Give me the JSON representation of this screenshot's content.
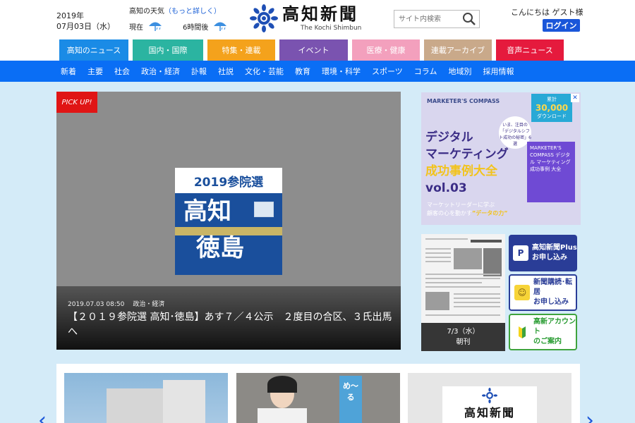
{
  "header": {
    "date_year": "2019年",
    "date_day": "07月03日（水）",
    "weather_label": "高知の天気",
    "weather_more": "（もっと詳しく）",
    "weather_now": "現在",
    "weather_later": "6時間後",
    "logo_title": "高知新聞",
    "logo_sub": "The Kochi Shimbun",
    "search_placeholder": "サイト内検索",
    "greeting": "こんにちは ゲスト様",
    "login_label": "ログイン"
  },
  "category_tabs": [
    {
      "label": "高知のニュース",
      "color": "#1a8be6"
    },
    {
      "label": "国内・国際",
      "color": "#2bb4a1"
    },
    {
      "label": "特集・連載",
      "color": "#f4a21c"
    },
    {
      "label": "イベント",
      "color": "#7a53b0"
    },
    {
      "label": "医療・健康",
      "color": "#f3a0bd"
    },
    {
      "label": "連載アーカイブ",
      "color": "#c9a98a"
    },
    {
      "label": "音声ニュース",
      "color": "#e51a3d"
    }
  ],
  "subnav": [
    "新着",
    "主要",
    "社会",
    "政治・経済",
    "訃報",
    "社説",
    "文化・芸能",
    "教育",
    "環境・科学",
    "スポーツ",
    "コラム",
    "地域別",
    "採用情報"
  ],
  "pickup": {
    "badge": "PICK UP!",
    "image_band": "2019参院選",
    "image_line1": "高知",
    "image_line2": "徳島",
    "date": "2019.07.03 08:50",
    "category": "政治・経済",
    "headline": "【２０１９参院選 高知･徳島】あす７／４公示　２度目の合区、３氏出馬へ"
  },
  "ad": {
    "brand": "MARKETER'S COMPASS",
    "counter_top": "累計",
    "counter_num": "30,000",
    "counter_bottom": "ダウンロード",
    "bubble": "いま、注目の「デジタルシフト成功の秘密」6選",
    "headline_1": "デジタル",
    "headline_2": "マーケティング",
    "headline_3": "成功事例大全",
    "headline_4": "vol.03",
    "book_text": "MARKETER'S COMPASS デジタル マーケティング 成功事例 大全",
    "small_1": "マーケットリーダーに学ぶ",
    "small_2a": "顧客の心を動かす",
    "small_2b": "”データの力”",
    "close": "✕"
  },
  "newspaper": {
    "date": "7/3（水）",
    "edition": "朝刊"
  },
  "side_buttons": {
    "plus_line1": "高知新聞Plus",
    "plus_line2": "お申し込み",
    "plus_icon": "P",
    "sub_line1": "新聞購読･転居",
    "sub_line2": "お申し込み",
    "sub_icon": "☺",
    "acct_line1": "高新アカウント",
    "acct_line2": "のご案内",
    "acct_icon": "▲"
  },
  "carousel": {
    "card2_sign": "め〜る",
    "card3_logo": "高知新聞",
    "prev_arrow": "‹",
    "next_arrow": "›"
  }
}
